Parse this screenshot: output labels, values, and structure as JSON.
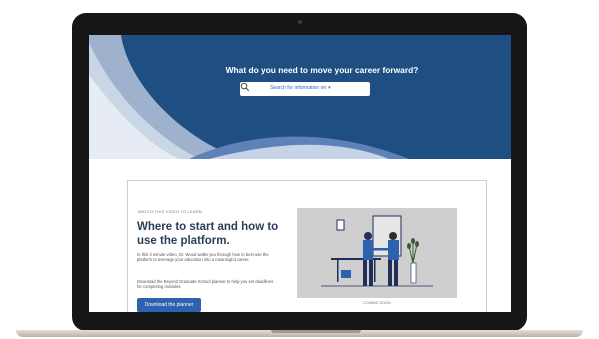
{
  "hero": {
    "title": "What do you need to move your career forward?",
    "search_placeholder": "Search for information on",
    "search_caret": "▾",
    "background_color": "#1e4e82"
  },
  "card": {
    "eyebrow": "WATCH THIS VIDEO TO LEARN",
    "title": "Where to start and how to use the platform.",
    "description": "In this 3 minute video, Dr. Wood walks you through how to best use the platform to leverage your education into a meaningful career.",
    "description2": "Download the Beyond Graduate School planner to help you set deadlines for completing modules.",
    "button_label": "Download the planner",
    "coming_soon": "COMING SOON",
    "illustration_icon": "business-handshake-illustration",
    "accent_color": "#2d62ae"
  }
}
